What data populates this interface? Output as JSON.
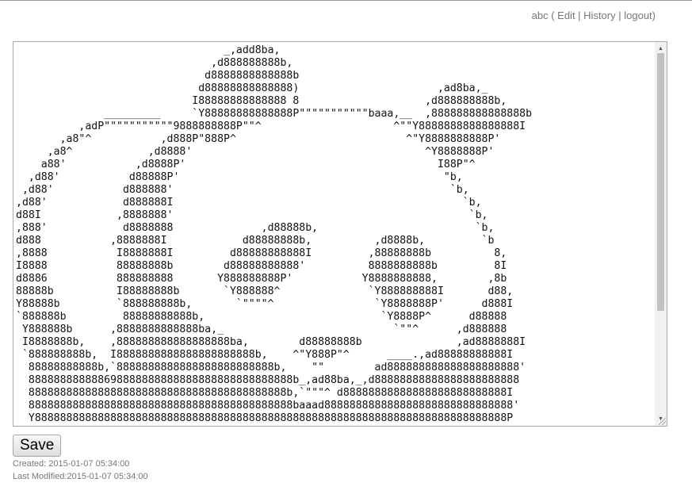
{
  "nav": {
    "user": "abc",
    "open_paren": " ( ",
    "edit": "Edit",
    "sep1": " | ",
    "history": "History",
    "sep2": " | ",
    "logout": "logout",
    "close_paren": ")"
  },
  "editor": {
    "content": "                                 _,add8ba,\n                               ,d888888888b,\n                              d8888888888888b\n                             d88888888888888)                      ,ad8ba,_\n                            I88888888888888 8                    ,d888888888b,\n              _________     `Y88888888888888P\"\"\"\"\"\"\"\"\"\"\"baaa,__  ,888888888888888b\n          ,adP\"\"\"\"\"\"\"\"\"\"\"9888888888P\"\"^                     ^\"\"Y8888888888888888I\n       ,a8\"^           ,d888P\"888P^                           ^\"Y8888888888P'\n     ,a8^            ,d8888'                                     ^Y8888888P'\n    a88'           ,d8888P'                                        I88P\"^\n  ,d88'           d88888P'                                          \"b,\n ,d88'           d888888'                                            `b,\n,d88'            d888888I                                              `b,\nd88I            ,8888888'                                               `b,\n,888'            d8888888              ,d88888b,                         `b,\nd888           ,8888888I            d88888888b,          ,d8888b,         `b\n,8888           I8888888I         d88888888888I         ,88888888b          8,\nI8888           88888888b        d88888888888'          8888888888b         8I\nd8886           888888888       Y888888888P'           Y8888888888,        ,8b\n88888b          I88888888b       `Y888888^              `Y888888888I       d88,\nY88888b         `888888888b,       `\"\"\"\"^                `Y8888888P'      d888I\n`888888b         88888888888b,                            `Y8888P^      d88888\n Y888888b      ,8888888888888ba,_                           `\"\"^      ,d888888\n I8888888b,    ,888888888888888888ba,        d88888888b               ,ad8888888I\n `888888888b,  I8888888888888888888888b,    ^\"Y888P\"^      ____.,ad88888888888I\n  88888888888b,`8888888888888888888888888b,    \"\"        ad888888888888888888888'\n  888888888888698888888888888888888888888888b_,ad88ba,_,d88888888888888888888888\n  88888888888888888888888888888888888888888b,`\"\"\"^ d88888888888888888888888888I\n  888888888888888888888888888888888888888888baaad888888888888888888888888888888'\n  Y888888888888888888888888888888888888888888888888888888888888888888888888888P"
  },
  "save_label": "Save",
  "meta": {
    "created": "Created: 2015-01-07 05:34:00",
    "modified": "Last Modified:2015-01-07 05:34:00"
  }
}
